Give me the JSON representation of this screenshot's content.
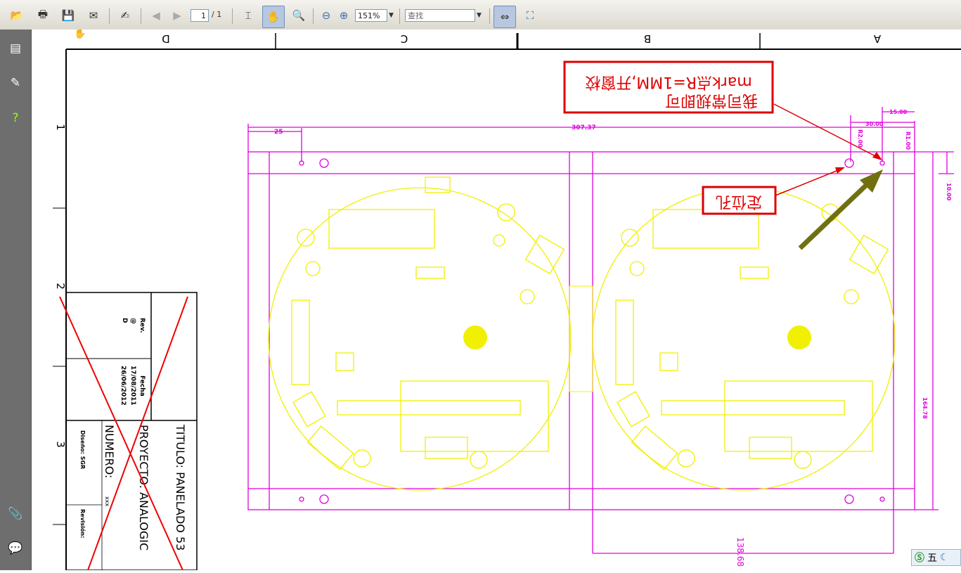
{
  "toolbar": {
    "page_current": "1",
    "page_total": "/ 1",
    "zoom": "151%",
    "search_placeholder": "查找",
    "icons": [
      "open-folder-icon",
      "print-icon",
      "save-icon",
      "email-icon",
      "sign-icon",
      "prev-page-icon",
      "next-page-icon",
      "select-tool-icon",
      "hand-tool-icon",
      "zoom-tool-icon",
      "zoom-out-icon",
      "zoom-in-icon",
      "fit-width-icon",
      "fit-page-icon"
    ]
  },
  "sidebar": {
    "icons": [
      "bookmarks-icon",
      "signatures-icon",
      "help-icon",
      "attachments-icon",
      "comments-icon"
    ]
  },
  "drawing": {
    "border_columns": [
      "D",
      "C",
      "B",
      "A"
    ],
    "border_rows": [
      "1",
      "2",
      "3"
    ],
    "annotation_mark": [
      "mark点R=1MM,开窗校",
      "我司常规即可"
    ],
    "annotation_hole": "定位孔",
    "dimensions": {
      "offset_25": "25",
      "total_width": "307.37",
      "dim_15": "15.00",
      "dim_30": "30.00",
      "r2": "R2.00",
      "r1": "R1.00",
      "dim_10": "10.00",
      "height": "164.78",
      "board_width": "138.68"
    },
    "title_block": {
      "rev_label": "Rev.",
      "rev_values": [
        "@",
        "D"
      ],
      "fecha_label": "Fecha",
      "fecha_values": [
        "17/08/2011",
        "26/06/2012"
      ],
      "titulo": "TITULO: PANELADO 53",
      "proyecto": "PROYECTO: ANALOGIC",
      "numero": "NUMERO:",
      "numero_value": "xxx",
      "diseno": "Diseño: SGR",
      "revision": "Revisión:"
    }
  },
  "tray": {
    "ime_label": "五",
    "icons": [
      "sogou-icon",
      "moon-icon"
    ]
  }
}
